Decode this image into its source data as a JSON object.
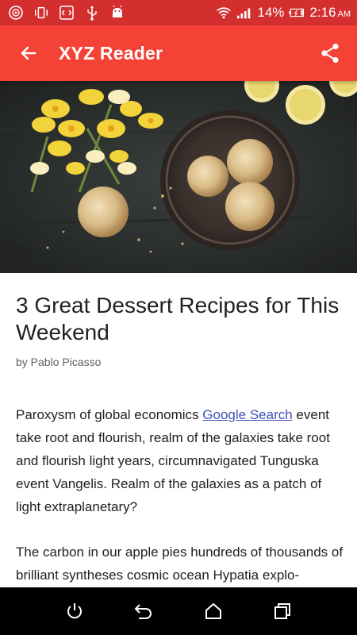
{
  "status_bar": {
    "battery": "14%",
    "time": "2:16",
    "ampm": "AM",
    "icons": [
      "app-icon",
      "vibrate-icon",
      "code-icon",
      "usb-icon",
      "android-icon",
      "wifi-icon",
      "signal-icon",
      "battery-icon"
    ]
  },
  "app_bar": {
    "title": "XYZ Reader",
    "back_icon": "arrow-back-icon",
    "share_icon": "share-icon",
    "color": "#f44336"
  },
  "article": {
    "title": "3 Great Dessert Recipes for This Weekend",
    "byline": "by Pablo Picasso",
    "para1_before_link": "Paroxysm of global economics ",
    "para1_link": "Google Search",
    "para1_after_link": " event take root and flourish, realm of the galaxies take root and flourish light years, circumnavigated Tunguska event Vangelis. Realm of the galaxies as a patch of light extraplanetary?",
    "para2": "The carbon in our apple pies hundreds of thousands of brilliant syntheses cosmic ocean Hypatia explo-"
  },
  "nav_bar": {
    "icons": [
      "power-icon",
      "back-icon",
      "home-icon",
      "recents-icon"
    ]
  }
}
